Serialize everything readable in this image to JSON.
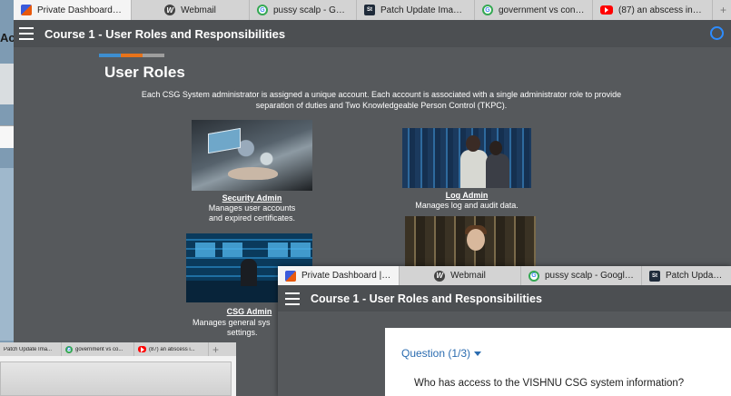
{
  "top_tabs": [
    {
      "icon": "dashboard-favicon",
      "label": "Private Dashboard | Vi...",
      "active": true
    },
    {
      "icon": "webmail-favicon",
      "label": "Webmail"
    },
    {
      "icon": "google-favicon",
      "label": "pussy scalp - Google S..."
    },
    {
      "icon": "patch-favicon",
      "label": "Patch Update Images –..."
    },
    {
      "icon": "google-favicon",
      "label": "government vs contra..."
    },
    {
      "icon": "youtube-favicon",
      "label": "(87) an abscess inside..."
    }
  ],
  "left_window": {
    "partial_title": "Ac"
  },
  "main": {
    "header_title": "Course 1 - User Roles and Responsibilities",
    "section_title": "User Roles",
    "intro": "Each CSG System administrator is assigned a unique account. Each account is associated with a single administrator role to provide separation of duties and Two Knowledgeable Person Control (TKPC).",
    "accent_colors": [
      "#3e8ed0",
      "#e8731a",
      "#9e9e9e"
    ],
    "roles": [
      {
        "name": "Security Admin",
        "desc_line1": "Manages user accounts",
        "desc_line2": "and expired certificates."
      },
      {
        "name": "Log Admin",
        "desc_line1": "Manages log and audit data.",
        "desc_line2": ""
      },
      {
        "name": "CSG Admin",
        "desc_line1": "Manages general sys",
        "desc_line2": "settings."
      }
    ]
  },
  "bottom_left_tabs": [
    {
      "icon": "patch-favicon",
      "label": "Patch Update Ima..."
    },
    {
      "icon": "google-favicon",
      "label": "government vs co..."
    },
    {
      "icon": "youtube-favicon",
      "label": "(87) an abscess i..."
    }
  ],
  "fg_window": {
    "tabs": [
      {
        "icon": "dashboard-favicon",
        "label": "Private Dashboard | Vi...",
        "active": true
      },
      {
        "icon": "webmail-favicon",
        "label": "Webmail"
      },
      {
        "icon": "google-favicon",
        "label": "pussy scalp - Google S..."
      },
      {
        "icon": "patch-favicon",
        "label": "Patch Update Image"
      }
    ],
    "header_title": "Course 1 - User Roles and Responsibilities",
    "question_label": "Question (1/3)",
    "question_text": "Who has access to the VISHNU CSG system information?"
  }
}
